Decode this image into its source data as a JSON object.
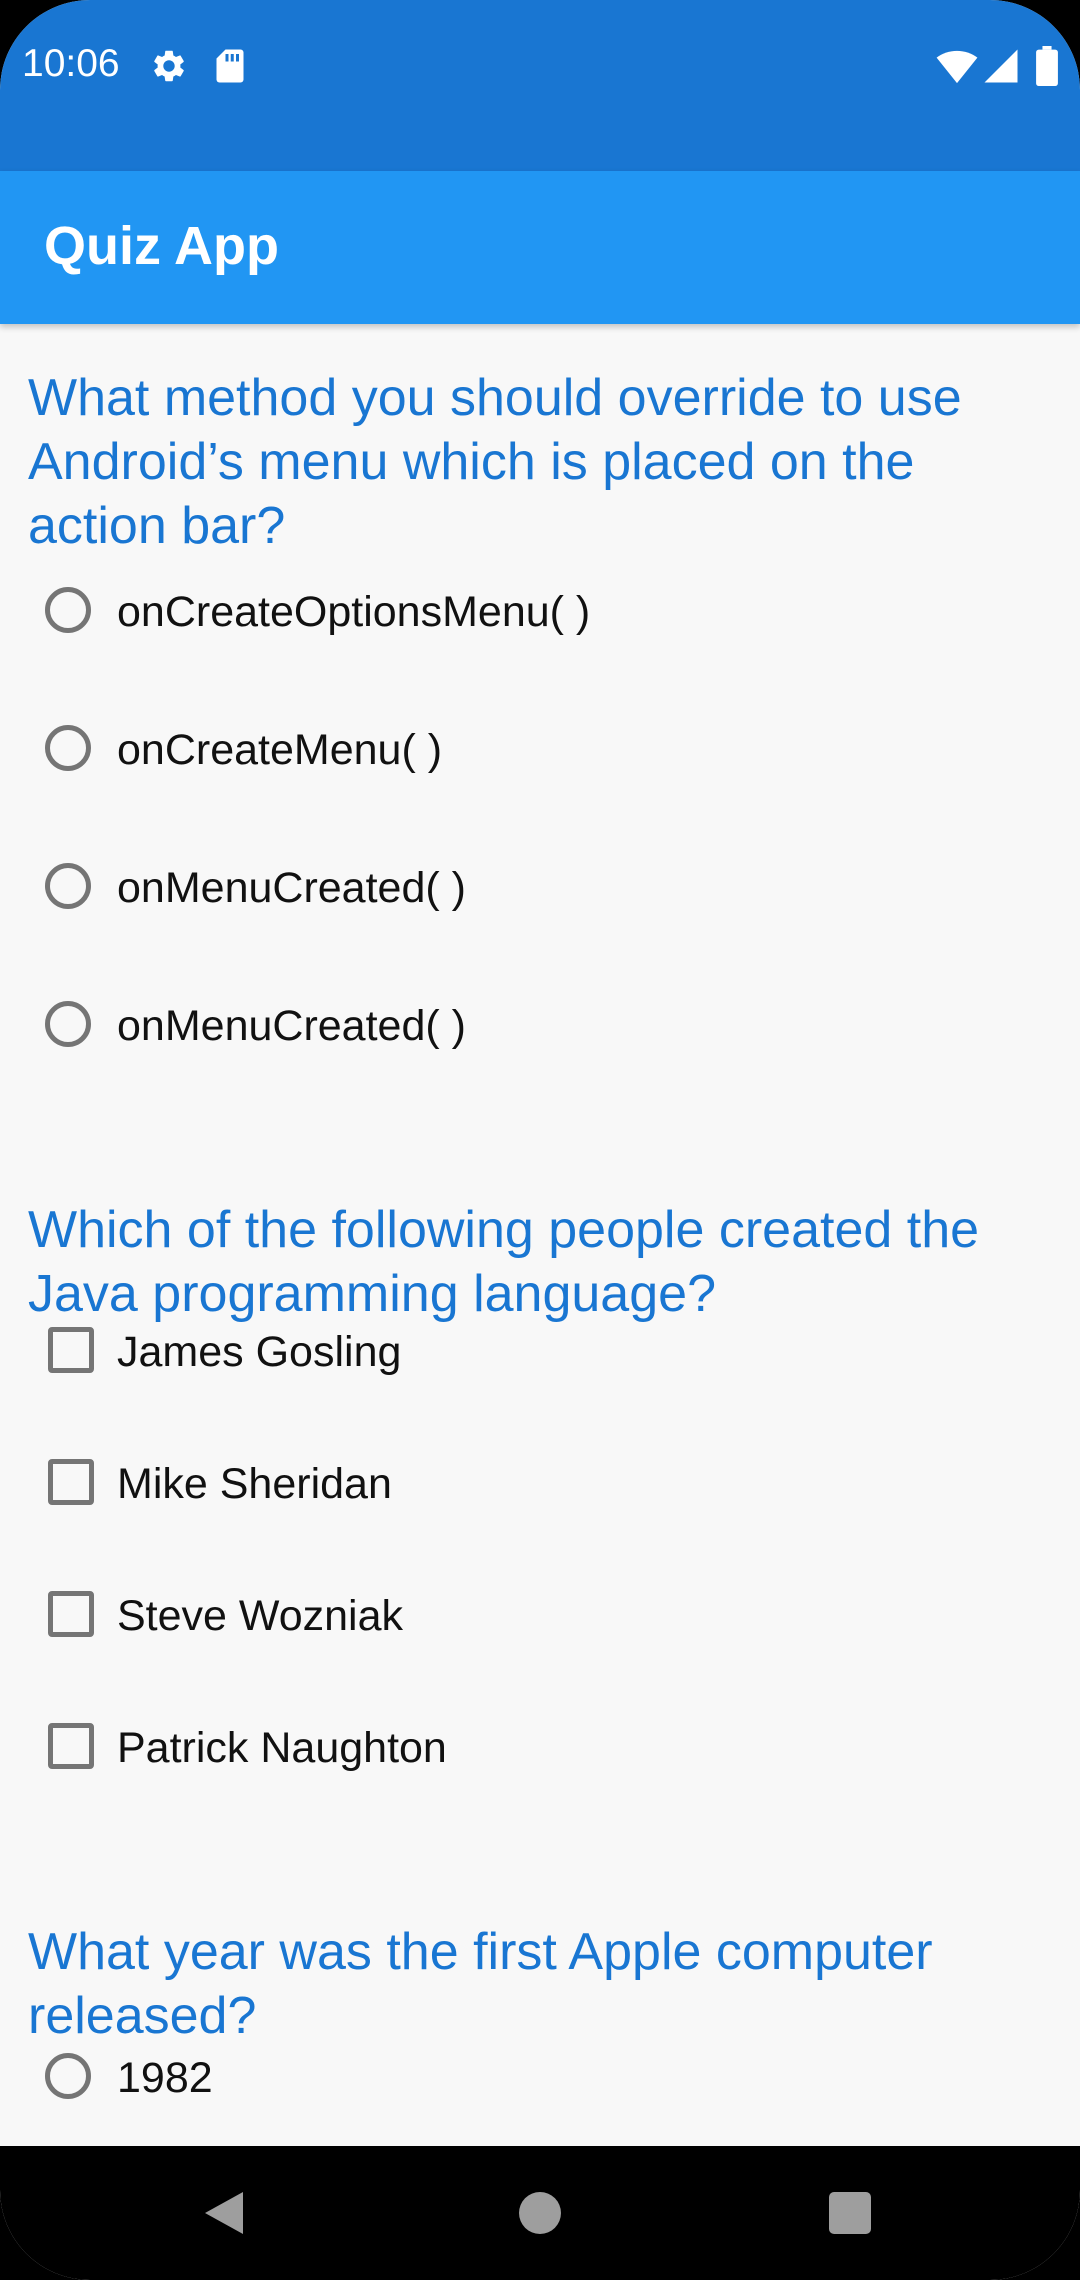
{
  "status_bar": {
    "time": "10:06",
    "icons": [
      "settings-icon",
      "sd-card-icon",
      "wifi-icon",
      "signal-icon",
      "battery-icon"
    ]
  },
  "app_bar": {
    "title": "Quiz App"
  },
  "questions": [
    {
      "text": "What method you should override to use Android’s menu which is placed on the action bar?",
      "input_type": "radio",
      "options": [
        "onCreateOptionsMenu( )",
        "onCreateMenu( )",
        "onMenuCreated( )",
        "onMenuCreated( )"
      ]
    },
    {
      "text": "Which of the following people created the Java programming language?",
      "input_type": "checkbox",
      "options": [
        "James Gosling",
        "Mike Sheridan",
        "Steve Wozniak",
        "Patrick Naughton"
      ]
    },
    {
      "text": "What year was the first Apple computer released?",
      "input_type": "radio",
      "options": [
        "1982"
      ]
    }
  ],
  "nav_bar": {
    "buttons": [
      "back-icon",
      "home-icon",
      "recents-icon"
    ]
  },
  "colors": {
    "status_bar": "#1976d2",
    "app_bar": "#2196f3",
    "question_text": "#1976d2",
    "background": "#f8f8f8"
  }
}
